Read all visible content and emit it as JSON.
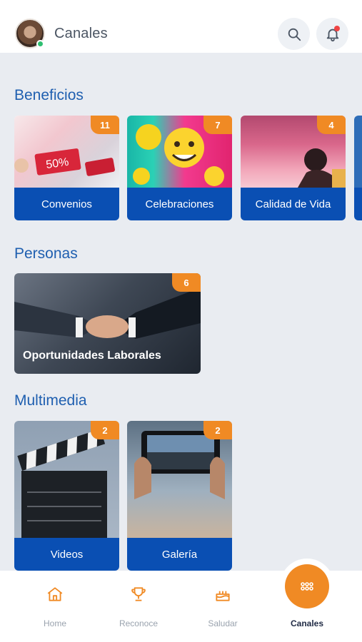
{
  "header": {
    "title": "Canales",
    "avatar_icon": "user-avatar",
    "search_icon": "search-icon",
    "bell_icon": "bell-icon"
  },
  "sections": {
    "beneficios": {
      "title": "Beneficios",
      "cards": [
        {
          "label": "Convenios",
          "count": "11"
        },
        {
          "label": "Celebraciones",
          "count": "7"
        },
        {
          "label": "Calidad de Vida",
          "count": "4"
        }
      ]
    },
    "personas": {
      "title": "Personas",
      "cards": [
        {
          "label": "Oportunidades Laborales",
          "count": "6"
        }
      ]
    },
    "multimedia": {
      "title": "Multimedia",
      "cards": [
        {
          "label": "Videos",
          "count": "2"
        },
        {
          "label": "Galería",
          "count": "2"
        }
      ]
    }
  },
  "nav": {
    "items": [
      {
        "label": "Home",
        "icon": "home-icon"
      },
      {
        "label": "Reconoce",
        "icon": "trophy-icon"
      },
      {
        "label": "Saludar",
        "icon": "cake-icon"
      },
      {
        "label": "Canales",
        "icon": "grid-icon"
      }
    ]
  },
  "colors": {
    "brand_blue": "#0a4fb3",
    "section_title": "#1f5fb0",
    "accent_orange": "#f08a24",
    "background": "#e9ecf1",
    "online": "#2fbf71"
  }
}
